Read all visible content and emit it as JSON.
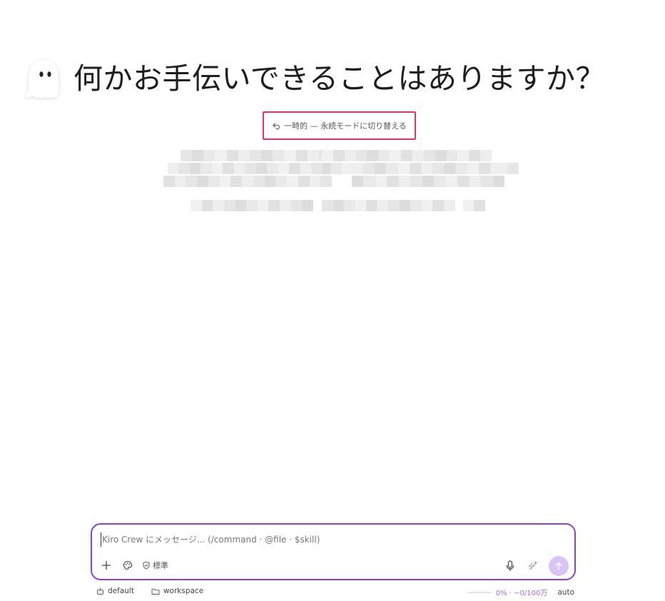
{
  "hero": {
    "icon": "ghost-icon",
    "title": "何かお手伝いできることはありますか？"
  },
  "mode_toggle": {
    "icon": "undo-arrow-icon",
    "label": "一時的 — 永続モードに切り替える",
    "highlight_color": "#e5316a"
  },
  "redacted_content": {
    "note": "",
    "bar_color": "#ebebeb"
  },
  "composer": {
    "placeholder": "Kiro Crew にメッセージ... (/command · @file · $skill)",
    "value": "",
    "border_color": "#8b3fe0",
    "tools": [
      {
        "name": "add-icon"
      },
      {
        "name": "palette-icon"
      }
    ],
    "mode_badge": {
      "icon": "shield-check-icon",
      "label": "標準"
    },
    "right_tools": [
      {
        "name": "microphone-icon"
      },
      {
        "name": "sparkle-icon"
      }
    ],
    "send_icon": "arrow-up-icon",
    "send_bg": "#d9c4f5"
  },
  "footer": {
    "profile_icon": "robot-icon",
    "profile": "default",
    "folder_icon": "folder-icon",
    "workspace": "workspace",
    "usage_percent": 0,
    "usage_text": "0% · ~0/100万",
    "usage_color": "#a56be3",
    "mode": "auto"
  }
}
